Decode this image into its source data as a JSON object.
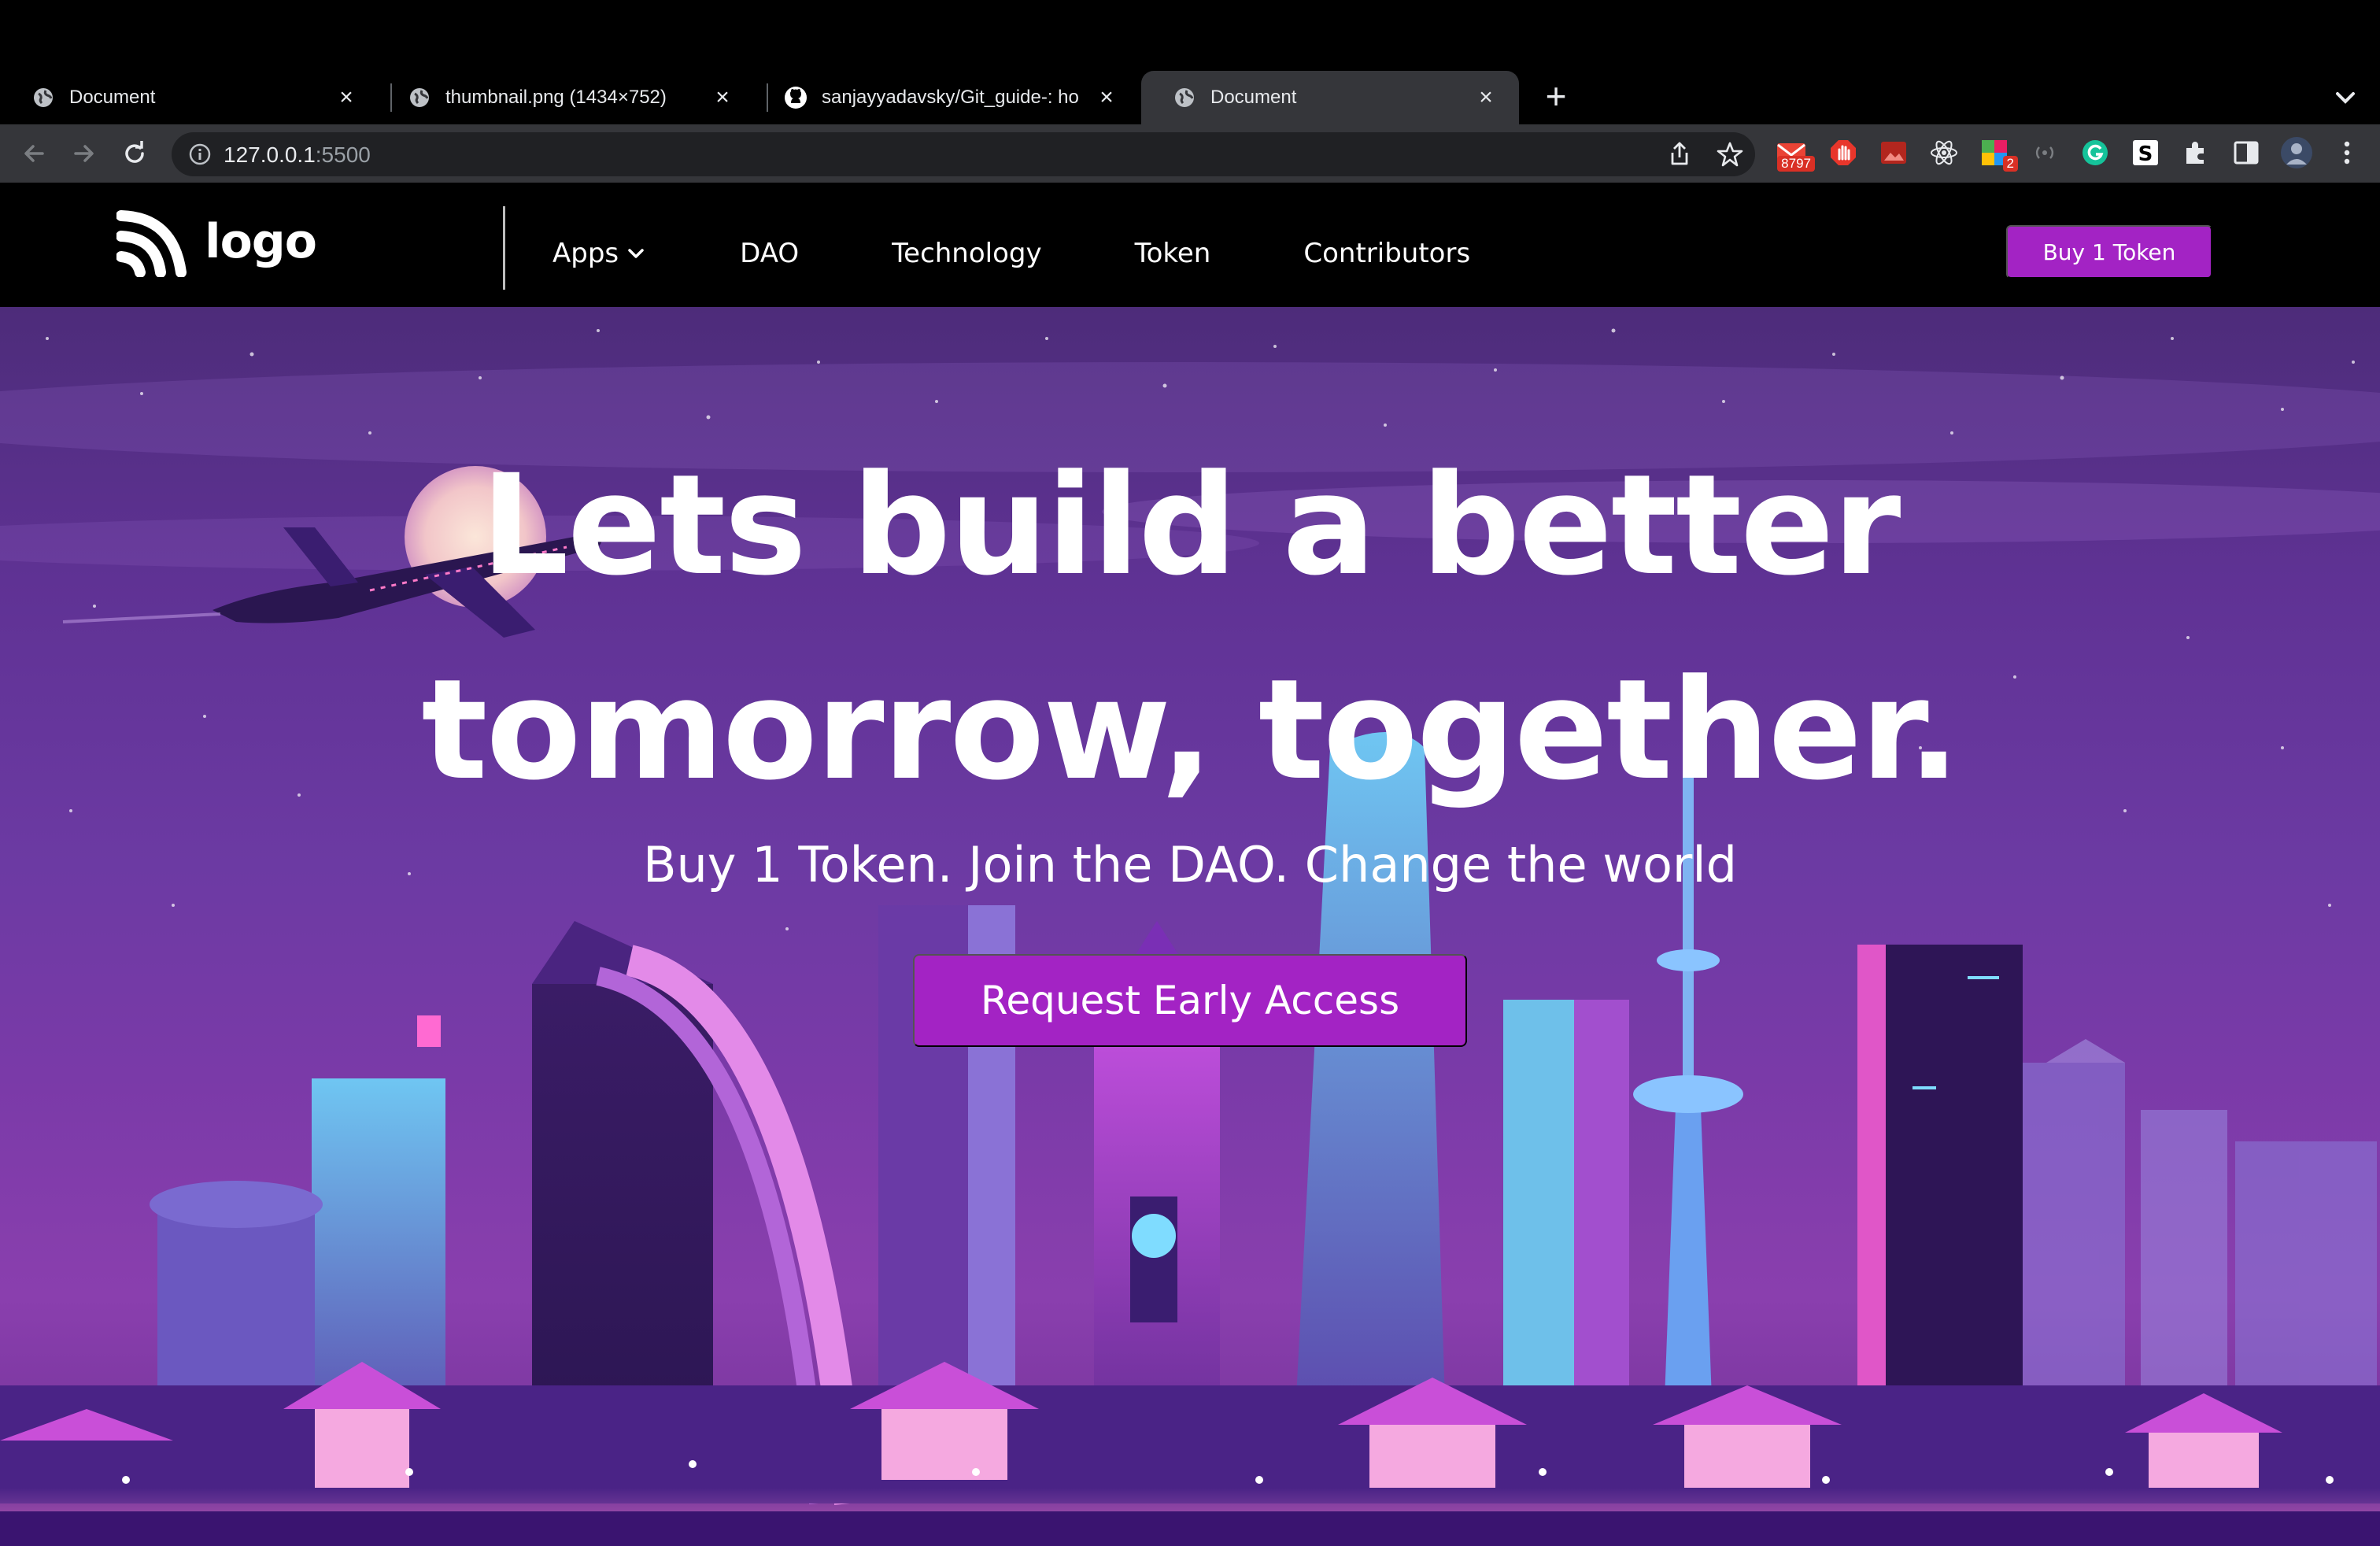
{
  "browser": {
    "tabs": [
      {
        "title": "Document",
        "active": false
      },
      {
        "title": "thumbnail.png (1434×752)",
        "active": false
      },
      {
        "title": "sanjayyadavsky/Git_guide-: ho",
        "active": false
      },
      {
        "title": "Document",
        "active": true
      }
    ],
    "new_tab_icon": "plus-icon",
    "url_host": "127.0.0.1",
    "url_port": ":5500",
    "extensions": [
      {
        "name": "gmail-extension-icon",
        "badge": "8797"
      },
      {
        "name": "adblock-extension-icon",
        "badge": ""
      },
      {
        "name": "image-extension-icon",
        "badge": ""
      },
      {
        "name": "react-devtools-icon",
        "badge": ""
      },
      {
        "name": "colorful-extension-icon",
        "badge": "2"
      },
      {
        "name": "wireless-extension-icon",
        "badge": ""
      },
      {
        "name": "grammarly-icon",
        "badge": ""
      },
      {
        "name": "s-extension-icon",
        "badge": ""
      },
      {
        "name": "puzzle-extensions-icon",
        "badge": ""
      },
      {
        "name": "side-panel-icon",
        "badge": ""
      },
      {
        "name": "profile-avatar",
        "badge": ""
      },
      {
        "name": "kebab-menu-icon",
        "badge": ""
      }
    ]
  },
  "site": {
    "logo_text": "logo",
    "nav": [
      {
        "label": "Apps",
        "has_dropdown": true
      },
      {
        "label": "DAO",
        "has_dropdown": false
      },
      {
        "label": "Technology",
        "has_dropdown": false
      },
      {
        "label": "Token",
        "has_dropdown": false
      },
      {
        "label": "Contributors",
        "has_dropdown": false
      }
    ],
    "buy_button": "Buy 1 Token",
    "colors": {
      "accent": "#a323c4",
      "nav_bg": "#000000",
      "hero_purple": "#6c3aa3"
    }
  },
  "hero": {
    "title_line1": "Lets build a better",
    "title_line2": "tomorrow, together.",
    "subtitle": "Buy 1 Token. Join the DAO. Change the world",
    "cta": "Request Early Access"
  }
}
